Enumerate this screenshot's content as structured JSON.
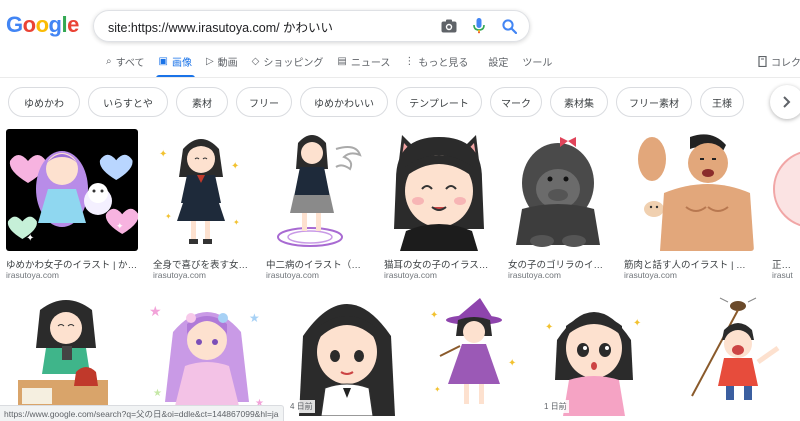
{
  "logo": [
    "G",
    "o",
    "o",
    "g",
    "l",
    "e"
  ],
  "search": {
    "query": "site:https://www.irasutoya.com/ かわいい"
  },
  "icons": {
    "camera": "camera-icon",
    "mic": "mic-icon",
    "search": "search-icon"
  },
  "tabs": [
    {
      "label": "すべて",
      "icon": "⌕",
      "active": false
    },
    {
      "label": "画像",
      "icon": "▣",
      "active": true
    },
    {
      "label": "動画",
      "icon": "▷",
      "active": false
    },
    {
      "label": "ショッピング",
      "icon": "◇",
      "active": false
    },
    {
      "label": "ニュース",
      "icon": "▤",
      "active": false
    },
    {
      "label": "もっと見る",
      "icon": "⋮",
      "active": false
    },
    {
      "label": "設定",
      "icon": "",
      "active": false
    },
    {
      "label": "ツール",
      "icon": "",
      "active": false
    }
  ],
  "collections_label": "コレク",
  "chips": [
    "ゆめかわ",
    "いらすとや",
    "素材",
    "フリー",
    "ゆめかわいい",
    "テンプレート",
    "マーク",
    "素材集",
    "フリー素材",
    "王様"
  ],
  "row1": [
    {
      "caption": "ゆめかわ女子のイラスト | かわ…",
      "source": "irasutoya.com"
    },
    {
      "caption": "全身で喜びを表す女子…",
      "source": "irasutoya.com"
    },
    {
      "caption": "中二病のイラスト（女性…",
      "source": "irasutoya.com"
    },
    {
      "caption": "猫耳の女の子のイラスト | …",
      "source": "irasutoya.com"
    },
    {
      "caption": "女の子のゴリラのイラ…",
      "source": "irasutoya.com"
    },
    {
      "caption": "筋肉と話す人のイラスト | かわ…",
      "source": "irasutoya.com"
    },
    {
      "caption": "正常細",
      "source": "irasut"
    }
  ],
  "row2_ages": [
    "4 日前",
    "1 日前"
  ],
  "status_url": "https://www.google.com/search?q=父の日&oi=ddle&ct=144867099&hl=ja",
  "colors": {
    "accent": "#1a73e8",
    "border": "#dadce0"
  }
}
